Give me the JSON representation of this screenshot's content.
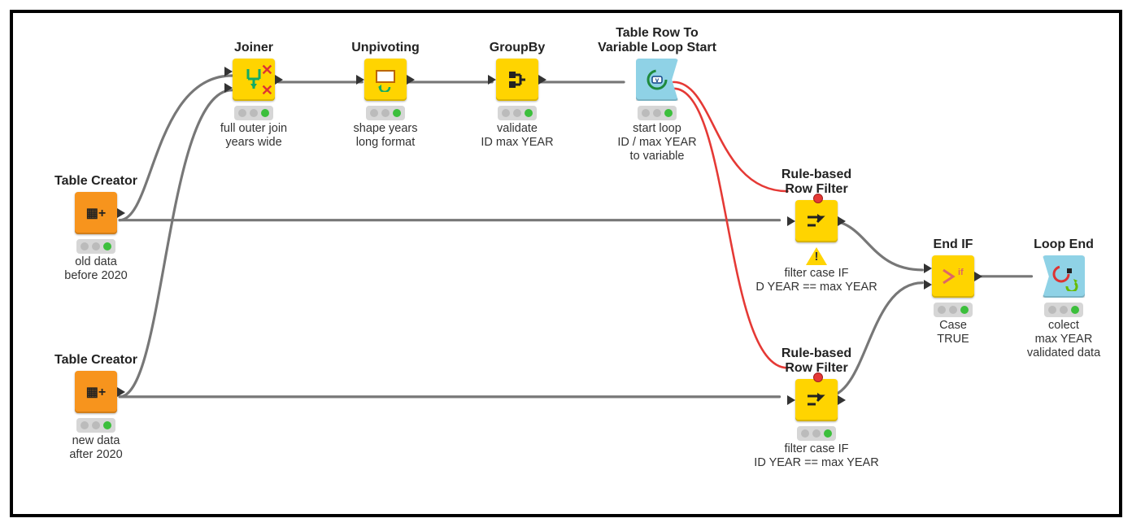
{
  "nodes": {
    "tc_old": {
      "title": "Table Creator",
      "label": "old data\nbefore 2020",
      "color": "orange",
      "status": "green"
    },
    "tc_new": {
      "title": "Table Creator",
      "label": "new data\nafter 2020",
      "color": "orange",
      "status": "green"
    },
    "joiner": {
      "title": "Joiner",
      "label": "full outer join\nyears wide",
      "color": "yellow",
      "status": "green"
    },
    "unpivot": {
      "title": "Unpivoting",
      "label": "shape years\nlong format",
      "color": "yellow",
      "status": "green"
    },
    "groupby": {
      "title": "GroupBy",
      "label": "validate\nID max YEAR",
      "color": "yellow",
      "status": "green"
    },
    "loopstart": {
      "title": "Table Row To\nVariable Loop Start",
      "label": "start loop\nID / max YEAR\nto variable",
      "color": "cyan",
      "status": "green"
    },
    "rule1": {
      "title": "Rule-based\nRow Filter",
      "label": "filter case IF\nD YEAR == max YEAR",
      "color": "yellow",
      "status": "warn"
    },
    "rule2": {
      "title": "Rule-based\nRow Filter",
      "label": "filter case IF\nID YEAR == max YEAR",
      "color": "yellow",
      "status": "green"
    },
    "endif": {
      "title": "End IF",
      "label": "Case\nTRUE",
      "color": "yellow",
      "status": "green"
    },
    "loopend": {
      "title": "Loop End",
      "label": "colect\nmax YEAR\nvalidated data",
      "color": "cyan",
      "status": "green"
    }
  },
  "connections_data": [
    {
      "from": "tc_old",
      "to": "joiner",
      "type": "data"
    },
    {
      "from": "tc_new",
      "to": "joiner",
      "type": "data"
    },
    {
      "from": "joiner",
      "to": "unpivot",
      "type": "data"
    },
    {
      "from": "unpivot",
      "to": "groupby",
      "type": "data"
    },
    {
      "from": "groupby",
      "to": "loopstart",
      "type": "data"
    },
    {
      "from": "tc_old",
      "to": "rule1",
      "type": "data"
    },
    {
      "from": "tc_new",
      "to": "rule2",
      "type": "data"
    },
    {
      "from": "rule1",
      "to": "endif",
      "type": "data"
    },
    {
      "from": "rule2",
      "to": "endif",
      "type": "data"
    },
    {
      "from": "endif",
      "to": "loopend",
      "type": "data"
    }
  ],
  "connections_variable": [
    {
      "from": "loopstart",
      "to": "rule1",
      "type": "flow-variable"
    },
    {
      "from": "loopstart",
      "to": "rule2",
      "type": "flow-variable"
    }
  ]
}
